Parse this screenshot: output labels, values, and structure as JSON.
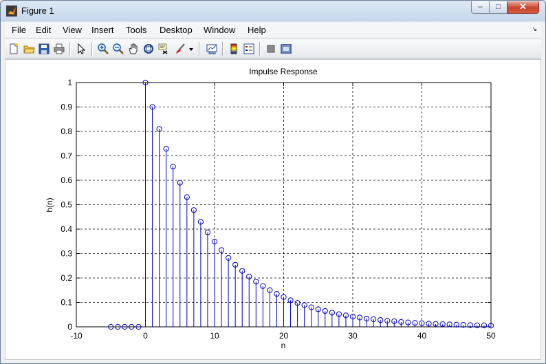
{
  "window": {
    "title": "Figure 1",
    "min_glyph": "–",
    "max_glyph": "□",
    "close_glyph": "✕"
  },
  "menu": [
    "File",
    "Edit",
    "View",
    "Insert",
    "Tools",
    "Desktop",
    "Window",
    "Help"
  ],
  "menu_overflow": "↘",
  "toolbar_icons": [
    "new-figure-icon",
    "open-file-icon",
    "save-icon",
    "print-icon",
    "pointer-icon",
    "zoom-in-icon",
    "zoom-out-icon",
    "pan-hand-icon",
    "rotate-3d-icon",
    "data-cursor-icon",
    "brush-icon",
    "dropdown-arrow-icon",
    "link-plot-icon",
    "colorbar-icon",
    "legend-icon",
    "hide-plot-tools-icon",
    "show-plot-tools-icon"
  ],
  "chart_data": {
    "type": "stem",
    "title": "Impulse Response",
    "xlabel": "n",
    "ylabel": "h(n)",
    "xlim": [
      -10,
      50
    ],
    "ylim": [
      0,
      1
    ],
    "xticks": [
      "-10",
      "0",
      "10",
      "20",
      "30",
      "40",
      "50"
    ],
    "yticks": [
      "0",
      "0.1",
      "0.2",
      "0.3",
      "0.4",
      "0.5",
      "0.6",
      "0.7",
      "0.8",
      "0.9",
      "1"
    ],
    "grid": true,
    "color": "#0000c0",
    "x": [
      -5,
      -4,
      -3,
      -2,
      -1,
      0,
      1,
      2,
      3,
      4,
      5,
      6,
      7,
      8,
      9,
      10,
      11,
      12,
      13,
      14,
      15,
      16,
      17,
      18,
      19,
      20,
      21,
      22,
      23,
      24,
      25,
      26,
      27,
      28,
      29,
      30,
      31,
      32,
      33,
      34,
      35,
      36,
      37,
      38,
      39,
      40,
      41,
      42,
      43,
      44,
      45,
      46,
      47,
      48,
      49,
      50
    ],
    "values": [
      0,
      0,
      0,
      0,
      0,
      1,
      0.9,
      0.81,
      0.729,
      0.656,
      0.59,
      0.531,
      0.478,
      0.43,
      0.387,
      0.349,
      0.314,
      0.282,
      0.254,
      0.229,
      0.206,
      0.185,
      0.167,
      0.15,
      0.135,
      0.122,
      0.109,
      0.098,
      0.089,
      0.08,
      0.072,
      0.065,
      0.058,
      0.052,
      0.047,
      0.042,
      0.038,
      0.034,
      0.031,
      0.028,
      0.025,
      0.023,
      0.02,
      0.018,
      0.016,
      0.015,
      0.013,
      0.012,
      0.011,
      0.01,
      0.009,
      0.008,
      0.007,
      0.006,
      0.006,
      0.005
    ]
  }
}
